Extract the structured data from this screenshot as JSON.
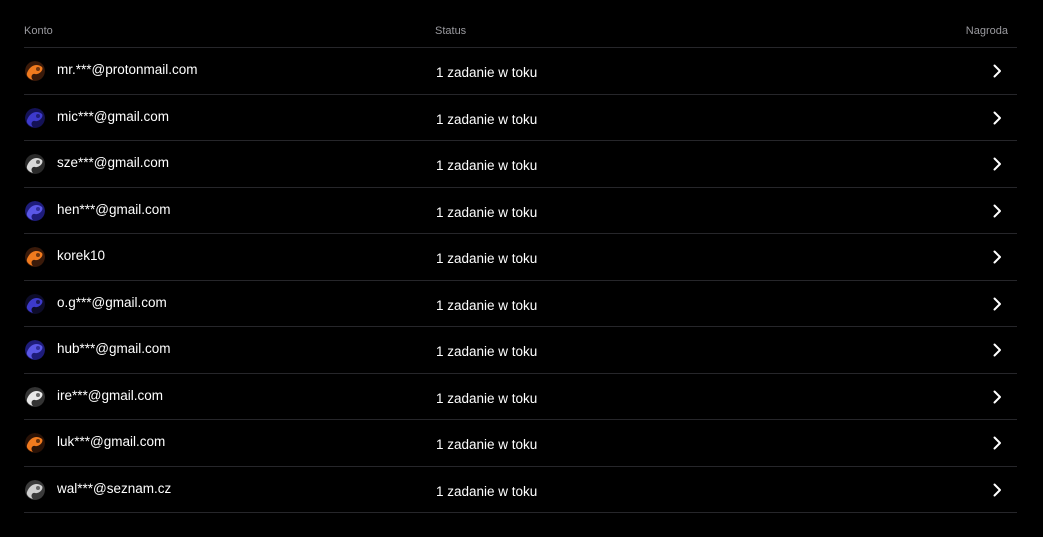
{
  "header": {
    "account_label": "Konto",
    "status_label": "Status",
    "reward_label": "Nagroda"
  },
  "rows": [
    {
      "account": "mr.***@protonmail.com",
      "status": "1 zadanie w toku",
      "avatar_colors": [
        "#f07a1e",
        "#3a1a0a"
      ]
    },
    {
      "account": "mic***@gmail.com",
      "status": "1 zadanie w toku",
      "avatar_colors": [
        "#3d3acb",
        "#141256"
      ]
    },
    {
      "account": "sze***@gmail.com",
      "status": "1 zadanie w toku",
      "avatar_colors": [
        "#d8d8d8",
        "#2a2a2a"
      ]
    },
    {
      "account": "hen***@gmail.com",
      "status": "1 zadanie w toku",
      "avatar_colors": [
        "#5a57e6",
        "#1e1c7a"
      ]
    },
    {
      "account": "korek10",
      "status": "1 zadanie w toku",
      "avatar_colors": [
        "#f07a1e",
        "#3a1a0a"
      ]
    },
    {
      "account": "o.g***@gmail.com",
      "status": "1 zadanie w toku",
      "avatar_colors": [
        "#3d3acb",
        "#0d0c2a"
      ]
    },
    {
      "account": "hub***@gmail.com",
      "status": "1 zadanie w toku",
      "avatar_colors": [
        "#5a57e6",
        "#1e1c7a"
      ]
    },
    {
      "account": "ire***@gmail.com",
      "status": "1 zadanie w toku",
      "avatar_colors": [
        "#e8e8e8",
        "#333333"
      ]
    },
    {
      "account": "luk***@gmail.com",
      "status": "1 zadanie w toku",
      "avatar_colors": [
        "#f07a1e",
        "#2a1206"
      ]
    },
    {
      "account": "wal***@seznam.cz",
      "status": "1 zadanie w toku",
      "avatar_colors": [
        "#cfcfcf",
        "#3a3a3a"
      ]
    }
  ]
}
